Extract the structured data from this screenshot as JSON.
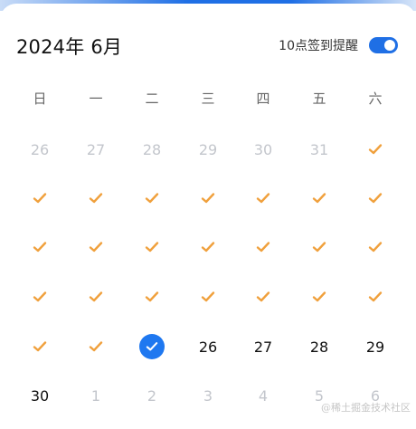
{
  "header": {
    "title": "2024年 6月",
    "reminder_label": "10点签到提醒",
    "reminder_enabled": true
  },
  "colors": {
    "accent": "#1f78f0",
    "checked": "#f0a03c",
    "muted_text": "#c3c6cc"
  },
  "weekdays": [
    "日",
    "一",
    "二",
    "三",
    "四",
    "五",
    "六"
  ],
  "rows": [
    [
      {
        "text": "26",
        "state": "other"
      },
      {
        "text": "27",
        "state": "other"
      },
      {
        "text": "28",
        "state": "other"
      },
      {
        "text": "29",
        "state": "other"
      },
      {
        "text": "30",
        "state": "other"
      },
      {
        "text": "31",
        "state": "other"
      },
      {
        "text": "",
        "state": "checked",
        "icon": "checkmark-icon"
      }
    ],
    [
      {
        "text": "",
        "state": "checked",
        "icon": "checkmark-icon"
      },
      {
        "text": "",
        "state": "checked",
        "icon": "checkmark-icon"
      },
      {
        "text": "",
        "state": "checked",
        "icon": "checkmark-icon"
      },
      {
        "text": "",
        "state": "checked",
        "icon": "checkmark-icon"
      },
      {
        "text": "",
        "state": "checked",
        "icon": "checkmark-icon"
      },
      {
        "text": "",
        "state": "checked",
        "icon": "checkmark-icon"
      },
      {
        "text": "",
        "state": "checked",
        "icon": "checkmark-icon"
      }
    ],
    [
      {
        "text": "",
        "state": "checked",
        "icon": "checkmark-icon"
      },
      {
        "text": "",
        "state": "checked",
        "icon": "checkmark-icon"
      },
      {
        "text": "",
        "state": "checked",
        "icon": "checkmark-icon"
      },
      {
        "text": "",
        "state": "checked",
        "icon": "checkmark-icon"
      },
      {
        "text": "",
        "state": "checked",
        "icon": "checkmark-icon"
      },
      {
        "text": "",
        "state": "checked",
        "icon": "checkmark-icon"
      },
      {
        "text": "",
        "state": "checked",
        "icon": "checkmark-icon"
      }
    ],
    [
      {
        "text": "",
        "state": "checked",
        "icon": "checkmark-icon"
      },
      {
        "text": "",
        "state": "checked",
        "icon": "checkmark-icon"
      },
      {
        "text": "",
        "state": "checked",
        "icon": "checkmark-icon"
      },
      {
        "text": "",
        "state": "checked",
        "icon": "checkmark-icon"
      },
      {
        "text": "",
        "state": "checked",
        "icon": "checkmark-icon"
      },
      {
        "text": "",
        "state": "checked",
        "icon": "checkmark-icon"
      },
      {
        "text": "",
        "state": "checked",
        "icon": "checkmark-icon"
      }
    ],
    [
      {
        "text": "",
        "state": "checked",
        "icon": "checkmark-icon"
      },
      {
        "text": "",
        "state": "checked",
        "icon": "checkmark-icon"
      },
      {
        "text": "",
        "state": "today",
        "icon": "today-check-icon"
      },
      {
        "text": "26",
        "state": "current"
      },
      {
        "text": "27",
        "state": "current"
      },
      {
        "text": "28",
        "state": "current"
      },
      {
        "text": "29",
        "state": "current"
      }
    ],
    [
      {
        "text": "30",
        "state": "current"
      },
      {
        "text": "1",
        "state": "other"
      },
      {
        "text": "2",
        "state": "other"
      },
      {
        "text": "3",
        "state": "other"
      },
      {
        "text": "4",
        "state": "other"
      },
      {
        "text": "5",
        "state": "other"
      },
      {
        "text": "6",
        "state": "other"
      }
    ]
  ],
  "watermark": "@稀土掘金技术社区"
}
